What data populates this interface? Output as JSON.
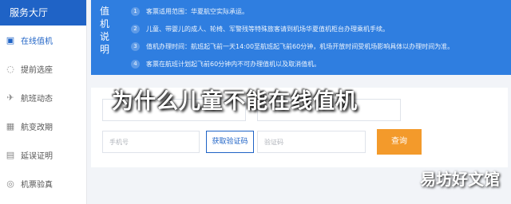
{
  "sidebar": {
    "header": "服务大厅",
    "items": [
      {
        "label": "在线值机",
        "icon": "checkin-icon",
        "active": true
      },
      {
        "label": "提前选座",
        "icon": "seat-icon"
      },
      {
        "label": "航班动态",
        "icon": "plane-icon"
      },
      {
        "label": "航变改期",
        "icon": "calendar-icon"
      },
      {
        "label": "延误证明",
        "icon": "document-icon"
      },
      {
        "label": "机票验真",
        "icon": "ticket-icon"
      }
    ]
  },
  "banner": {
    "title": "值机说明",
    "tips": [
      {
        "num": "1",
        "text": "客票适用范围：华夏航空实际承运。"
      },
      {
        "num": "2",
        "text": "儿童、带婴儿的成人、轮椅、军警残等特殊旅客请到机场华夏值机柜台办理乘机手续。"
      },
      {
        "num": "3",
        "text": "值机办理时间：航班起飞前一天14:00至航班起飞前60分钟，机场开放时间受机场影响具体以办理时间为准。"
      },
      {
        "num": "4",
        "text": "客票在航班计划起飞前60分钟内不可办理值机以及取消值机。"
      }
    ]
  },
  "form": {
    "phone_placeholder": "手机号",
    "code_placeholder": "验证码",
    "get_code_label": "获取验证码",
    "query_label": "查询"
  },
  "overlay_caption": "为什么儿童不能在线值机",
  "watermark": "易坊好文馆",
  "colors": {
    "primary": "#1f63c6",
    "banner": "#2f7ee0",
    "accent": "#f39a2b"
  }
}
